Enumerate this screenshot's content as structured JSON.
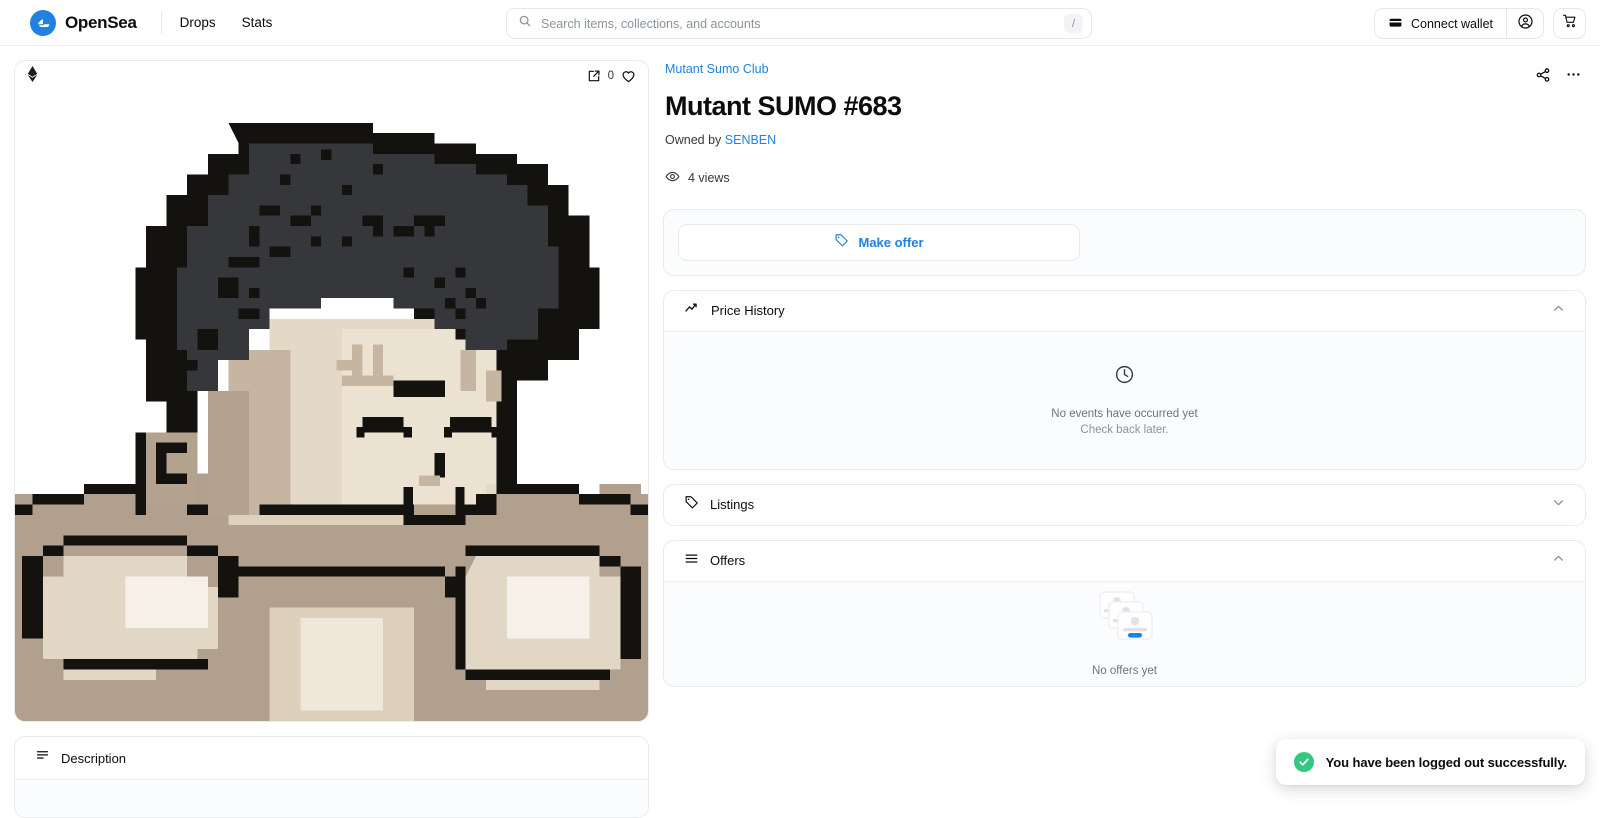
{
  "header": {
    "brand": "OpenSea",
    "logo_icon": "opensea-sail-logo",
    "nav": [
      {
        "label": "Drops"
      },
      {
        "label": "Stats"
      }
    ],
    "search": {
      "placeholder": "Search items, collections, and accounts",
      "value": "",
      "icon": "search-icon",
      "shortcut_key": "/"
    },
    "connect_wallet_label": "Connect wallet",
    "wallet_icon": "wallet-icon",
    "account_icon": "account-circle-icon",
    "cart_icon": "shopping-cart-icon"
  },
  "media": {
    "chain_icon": "ethereum-icon",
    "expand_icon": "open-in-new-icon",
    "like_count": "0",
    "like_icon": "heart-icon",
    "alt": "Mutant SUMO #683 pixel art sumo wrestler"
  },
  "item": {
    "collection": "Mutant Sumo Club",
    "title": "Mutant SUMO #683",
    "owned_by_label": "Owned by",
    "owner": "SENBEN",
    "views": "4 views",
    "views_icon": "eye-icon",
    "share_icon": "share-icon",
    "more_icon": "more-horizontal-icon"
  },
  "actions": {
    "make_offer_label": "Make offer",
    "make_offer_icon": "tag-icon"
  },
  "sections": {
    "price_history": {
      "title": "Price History",
      "icon": "trending-up-icon",
      "chevron": "chevron-up-icon",
      "expanded": true,
      "empty_icon": "clock-icon",
      "empty_title": "No events have occurred yet",
      "empty_subtitle": "Check back later."
    },
    "listings": {
      "title": "Listings",
      "icon": "tag-icon",
      "chevron": "chevron-down-icon",
      "expanded": false
    },
    "offers": {
      "title": "Offers",
      "icon": "list-icon",
      "chevron": "chevron-up-icon",
      "expanded": true,
      "empty_icon": "stacked-cards-icon",
      "empty_title": "No offers yet"
    },
    "description": {
      "title": "Description",
      "icon": "description-lines-icon",
      "chevron": "chevron-up-icon"
    }
  },
  "toast": {
    "message": "You have been logged out successfully.",
    "icon": "check-circle-icon",
    "accent_color": "#35c77f"
  },
  "colors": {
    "brand_blue": "#2081e2",
    "text_primary": "#0c0c0c",
    "text_secondary": "#353840",
    "text_muted": "#8a939b",
    "border": "#e5e8eb",
    "panel_bg": "#fbfcfd"
  }
}
